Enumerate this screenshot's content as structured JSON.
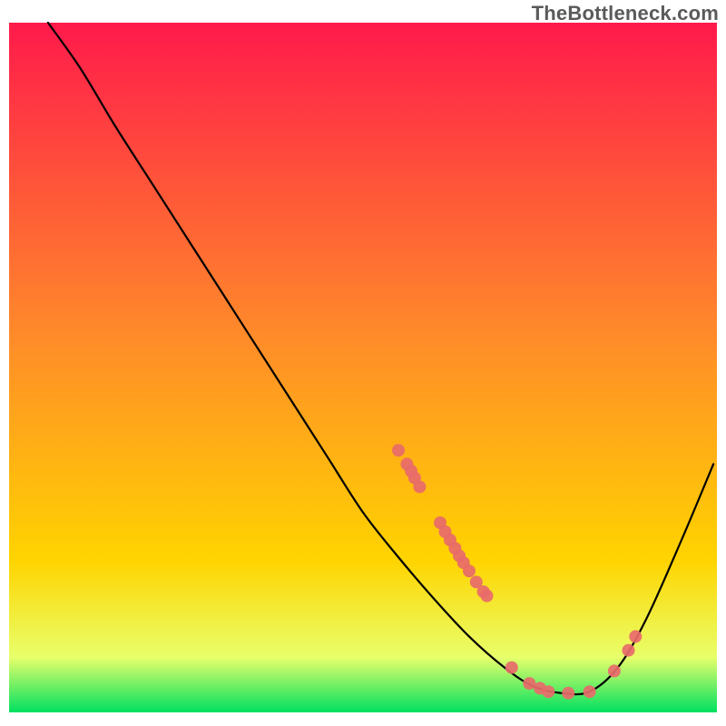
{
  "watermark": "TheBottleneck.com",
  "chart_data": {
    "type": "line",
    "title": "",
    "xlabel": "",
    "ylabel": "",
    "xlim": [
      0,
      100
    ],
    "ylim": [
      0,
      100
    ],
    "grid": false,
    "legend": false,
    "gradient": {
      "top": "#ff1a4b",
      "mid": "#ffd400",
      "bottom_band_top": "#e8ff6a",
      "bottom_band_bottom": "#00e060"
    },
    "curve": [
      {
        "x": 5.5,
        "y": 100.0
      },
      {
        "x": 10.0,
        "y": 93.5
      },
      {
        "x": 15.0,
        "y": 85.0
      },
      {
        "x": 20.0,
        "y": 77.0
      },
      {
        "x": 25.0,
        "y": 69.0
      },
      {
        "x": 30.0,
        "y": 61.0
      },
      {
        "x": 35.0,
        "y": 53.0
      },
      {
        "x": 40.0,
        "y": 45.0
      },
      {
        "x": 45.0,
        "y": 37.0
      },
      {
        "x": 50.0,
        "y": 29.0
      },
      {
        "x": 55.0,
        "y": 22.5
      },
      {
        "x": 60.0,
        "y": 16.5
      },
      {
        "x": 65.0,
        "y": 11.0
      },
      {
        "x": 70.0,
        "y": 6.5
      },
      {
        "x": 74.0,
        "y": 3.8
      },
      {
        "x": 78.0,
        "y": 2.8
      },
      {
        "x": 82.0,
        "y": 3.0
      },
      {
        "x": 86.0,
        "y": 6.5
      },
      {
        "x": 90.0,
        "y": 13.5
      },
      {
        "x": 95.0,
        "y": 25.0
      },
      {
        "x": 99.5,
        "y": 36.0
      }
    ],
    "overlay_points": [
      {
        "x": 55.0,
        "y": 38.0
      },
      {
        "x": 56.2,
        "y": 36.0
      },
      {
        "x": 56.8,
        "y": 35.0
      },
      {
        "x": 57.3,
        "y": 34.0
      },
      {
        "x": 58.0,
        "y": 32.7
      },
      {
        "x": 60.9,
        "y": 27.5
      },
      {
        "x": 61.6,
        "y": 26.2
      },
      {
        "x": 62.3,
        "y": 25.0
      },
      {
        "x": 63.0,
        "y": 23.8
      },
      {
        "x": 63.6,
        "y": 22.7
      },
      {
        "x": 64.2,
        "y": 21.7
      },
      {
        "x": 65.0,
        "y": 20.5
      },
      {
        "x": 66.0,
        "y": 18.9
      },
      {
        "x": 67.0,
        "y": 17.5
      },
      {
        "x": 67.5,
        "y": 16.9
      },
      {
        "x": 71.0,
        "y": 6.5
      },
      {
        "x": 73.5,
        "y": 4.2
      },
      {
        "x": 75.0,
        "y": 3.5
      },
      {
        "x": 76.2,
        "y": 3.0
      },
      {
        "x": 79.0,
        "y": 2.8
      },
      {
        "x": 82.0,
        "y": 3.0
      },
      {
        "x": 85.5,
        "y": 6.0
      },
      {
        "x": 87.5,
        "y": 9.0
      },
      {
        "x": 88.5,
        "y": 11.0
      }
    ],
    "point_color": "#e86a6a",
    "point_radius": 7
  }
}
